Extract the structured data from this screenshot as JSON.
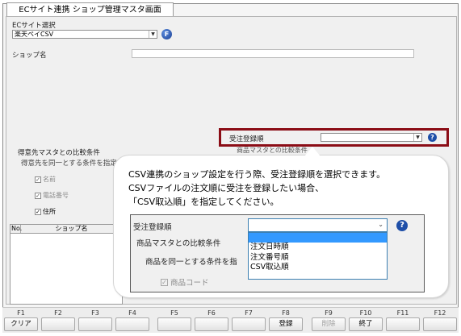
{
  "window": {
    "title": "ECサイト連携 ショップ管理マスタ画面"
  },
  "form": {
    "ec_site_label": "ECサイト選択",
    "ec_site_value": "楽天ペイCSV",
    "ec_icon": "F",
    "shop_name_label": "ショップ名",
    "customer_section_label": "得意先マスタとの比較条件",
    "customer_condition_label": "得意先を同一とする条件を指定",
    "checks": [
      {
        "label": "名前",
        "checked": true,
        "enabled": false
      },
      {
        "label": "電話番号",
        "checked": true,
        "enabled": false
      },
      {
        "label": "住所",
        "checked": true,
        "enabled": true
      }
    ],
    "order_register_label": "受注登録順",
    "order_register_value": "",
    "product_compare_label_partial": "商品マスタとの比較条件",
    "help_icon": "?"
  },
  "grid": {
    "columns": [
      "No.",
      "ショップ名"
    ]
  },
  "callout": {
    "lines": [
      "CSV連携のショップ設定を行う際、受注登録順を選択できます。",
      "CSVファイルの注文順に受注を登録したい場合、",
      "「CSV取込順」を指定してください。"
    ]
  },
  "inset": {
    "order_label": "受注登録順",
    "product_section_label": "商品マスタとの比較条件",
    "product_condition_label": "商品を同一とする条件を指",
    "product_code_label": "商品コード",
    "options": [
      "注文日時順",
      "注文番号順",
      "CSV取込順"
    ]
  },
  "fkeys": [
    {
      "num": "F1",
      "label": "クリア",
      "enabled": true
    },
    {
      "num": "F2",
      "label": "",
      "enabled": true
    },
    {
      "num": "F3",
      "label": "",
      "enabled": true
    },
    {
      "num": "F4",
      "label": "",
      "enabled": true
    },
    {
      "num": "F5",
      "label": "",
      "enabled": true
    },
    {
      "num": "F6",
      "label": "",
      "enabled": true
    },
    {
      "num": "F7",
      "label": "",
      "enabled": true
    },
    {
      "num": "F8",
      "label": "登録",
      "enabled": true
    },
    {
      "num": "F9",
      "label": "削除",
      "enabled": false
    },
    {
      "num": "F10",
      "label": "終了",
      "enabled": true
    },
    {
      "num": "F11",
      "label": "",
      "enabled": true
    },
    {
      "num": "F12",
      "label": "",
      "enabled": true
    }
  ]
}
